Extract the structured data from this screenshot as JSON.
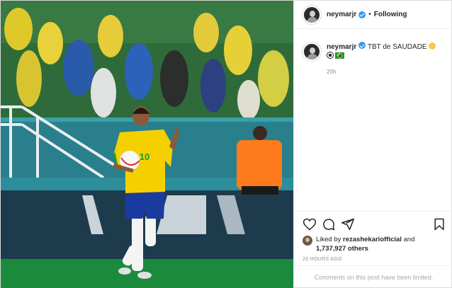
{
  "post": {
    "username": "neymarjr",
    "separator": "•",
    "follow_status": "Following",
    "caption_username": "neymarjr",
    "caption_text": "TBT de SAUDADE",
    "caption_time": "20h",
    "liked_by_prefix": "Liked by",
    "liked_by_user": "rezashekariofficial",
    "liked_by_and": "and",
    "likes_count": "1,737,927 others",
    "post_time": "20 HOURS AGO",
    "comments_notice": "Comments on this post have been limited."
  },
  "photo": {
    "jersey_number": "10",
    "brand_colors": {
      "pitch": "#1c7a3a",
      "jersey": "#f5d000",
      "shorts": "#1b3aa0",
      "referee": "#ff7a1a"
    }
  },
  "icons": [
    "heart-icon",
    "comment-icon",
    "share-icon",
    "bookmark-icon",
    "verified-icon"
  ]
}
